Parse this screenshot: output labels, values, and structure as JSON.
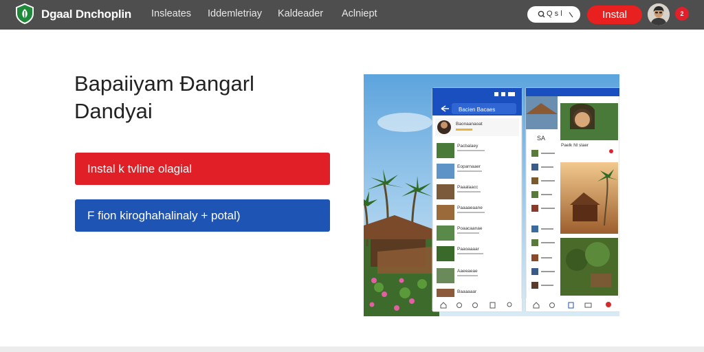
{
  "header": {
    "brand": "Dgaal Dnchoplin",
    "nav": [
      "Insleates",
      "Iddemletriay",
      "Kaldeader",
      "Aclniept"
    ],
    "search_label": "Q s ǀ",
    "install_label": "Instal",
    "notification_count": "2",
    "icons": {
      "logo": "leaf-shield-logo",
      "search": "search-icon",
      "caret": "caret-icon",
      "avatar": "user-avatar",
      "notification": "notification-badge"
    }
  },
  "hero": {
    "title_line1": "Bapaiiyam Đangarl",
    "title_line2": "Dandyai",
    "cta_primary": "Instal k tvline olagial",
    "cta_secondary": "F fion kiroghahalinaly  + potal)"
  },
  "showcase": {
    "left_phone": {
      "header_title": "Bacien Bacaes",
      "list_items": [
        "Baonaanaoat",
        "Pacbalaey",
        "Eoparnaaer",
        "Paaalaacc",
        "Paaaaeaane",
        "Poaacaanae",
        "Paaoaaaar",
        "Aaeeaeae",
        "Baaaaaar"
      ]
    },
    "right_phone": {
      "banner_label": "SA",
      "profile_label": "Paelk Nl slaer"
    }
  },
  "colors": {
    "topbar": "#4e4e4e",
    "install_red": "#e8201f",
    "cta_red": "#e11f26",
    "cta_blue": "#1e55b4",
    "app_blue": "#1a4fbf",
    "logo_green": "#1f8a3a"
  }
}
